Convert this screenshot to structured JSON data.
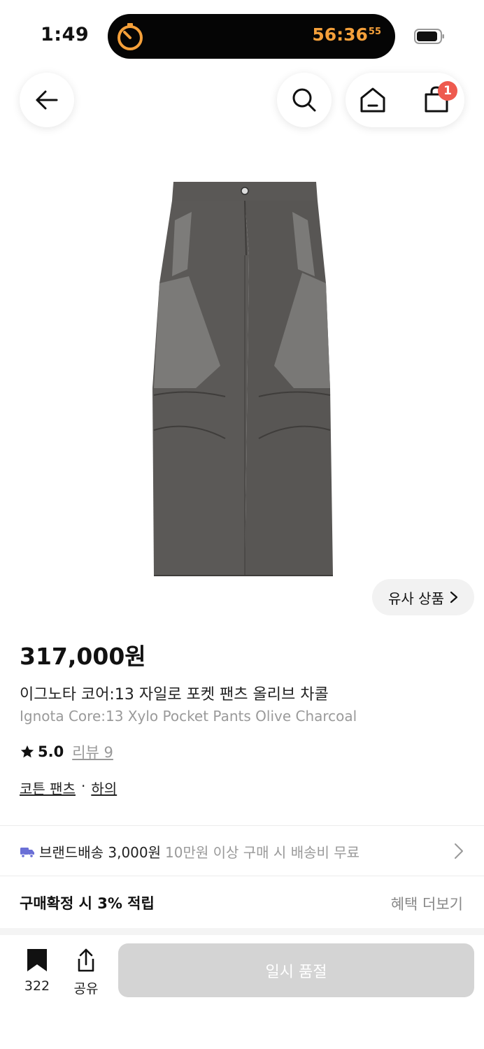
{
  "status_bar": {
    "time": "1:49",
    "timer_main": "56:36",
    "timer_sub": "55",
    "timer_color": "#f5a03a"
  },
  "header": {
    "back_icon": "arrow-left-icon",
    "search_icon": "search-icon",
    "home_icon": "home-icon",
    "cart_icon": "shopping-bag-icon",
    "cart_count": "1",
    "badge_color": "#ee5a4f"
  },
  "product": {
    "image_icon": "pants-product-image",
    "similar_label": "유사 상품",
    "price": "317,000원",
    "name_ko": "이그노타 코어:13 자일로 포켓 팬츠 올리브 차콜",
    "name_en": "Ignota Core:13 Xylo Pocket Pants Olive Charcoal",
    "rating": "5.0",
    "review_label": "리뷰 9",
    "category_main": "코튼 팬츠",
    "category_separator": "·",
    "category_parent": "하의"
  },
  "shipping": {
    "icon": "truck-icon",
    "label": "브랜드배송 3,000원",
    "condition": "10만원 이상 구매 시 배송비 무료"
  },
  "benefits": {
    "points_label": "구매확정 시 3% 적립",
    "more_label": "혜택 더보기"
  },
  "bottom_bar": {
    "bookmark_count": "322",
    "share_label": "공유",
    "buy_label": "일시 품절",
    "buy_disabled_color": "#d4d4d4"
  }
}
